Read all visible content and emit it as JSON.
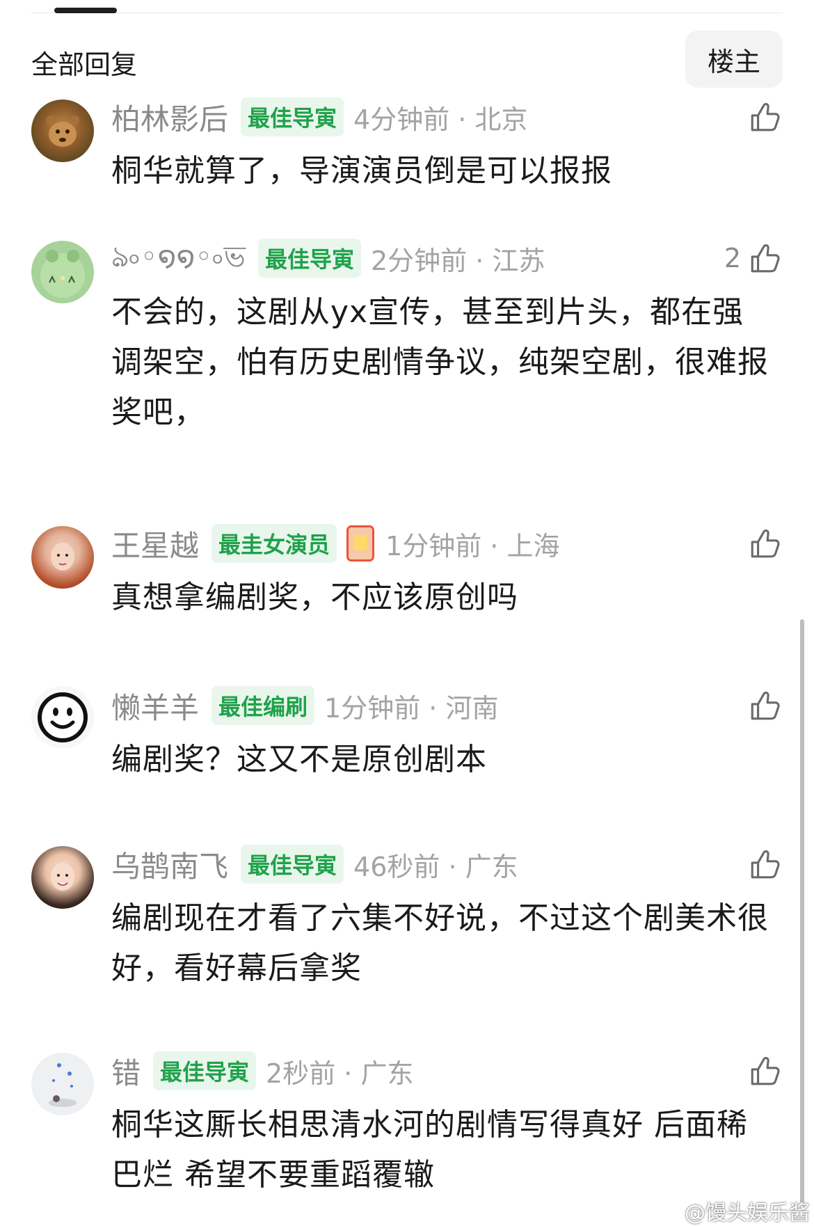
{
  "header": {
    "title": "全部回复",
    "op_button_label": "楼主"
  },
  "comments": [
    {
      "username": "柏林影后",
      "badge": "最佳导寅",
      "time": "4分钟前 · 北京",
      "likes": "",
      "text": "桐华就算了，导演演员倒是可以报报",
      "avatar": "lion-cub-photo"
    },
    {
      "username": "ঌ৹◦໑໑◦৹ভ",
      "badge": "最佳导寅",
      "time": "2分钟前 · 江苏",
      "likes": "2",
      "text": "不会的，这剧从yx宣传，甚至到片头，都在强调架空，怕有历史剧情争议，纯架空剧，很难报奖吧，",
      "avatar": "green-cartoon"
    },
    {
      "username": "王星越",
      "badge": "最圭女演员",
      "time": "1分钟前 · 上海",
      "likes": "",
      "text": "真想拿编剧奖，不应该原创吗",
      "avatar": "woman-photo-red-hair"
    },
    {
      "username": "懒羊羊",
      "badge": "最佳编刷",
      "time": "1分钟前 · 河南",
      "likes": "",
      "text": "编剧奖？这又不是原创剧本",
      "avatar": "smiley-face"
    },
    {
      "username": "乌鹊南飞",
      "badge": "最佳导寅",
      "time": "46秒前 · 广东",
      "likes": "",
      "text": "编剧现在才看了六集不好说，不过这个剧美术很好，看好幕后拿奖",
      "avatar": "woman-photo-smiling"
    },
    {
      "username": "错",
      "badge": "最佳导寅",
      "time": "2秒前 · 广东",
      "likes": "",
      "text": "桐华这厮长相思清水河的剧情写得真好 后面稀巴烂 希望不要重蹈覆辙",
      "avatar": "snow-scene"
    }
  ],
  "watermark": "@馒头娱乐酱",
  "colors": {
    "badge_bg": "#e9f6ec",
    "badge_text": "#1fa24a",
    "meta_text": "#8a8a8a"
  }
}
